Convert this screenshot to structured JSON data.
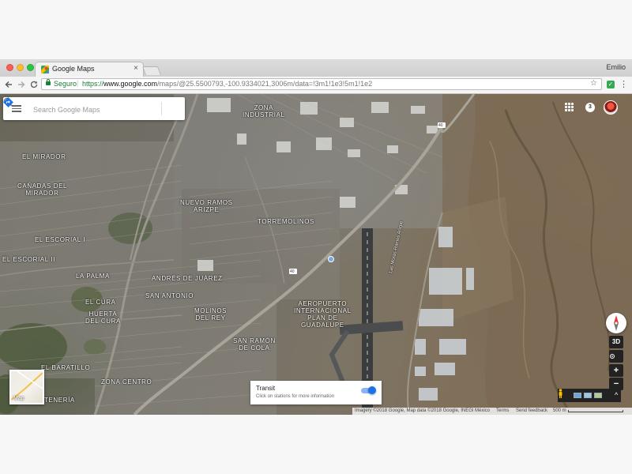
{
  "browser": {
    "tab_title": "Google Maps",
    "tab_close": "×",
    "profile_name": "Emilio",
    "secure_label": "Seguro",
    "url_scheme": "https://",
    "url_host": "www.google.com",
    "url_path": "/maps/@25.5500793,-100.9334021,3006m/data=!3m1!1e3!5m1!1e2",
    "back_icon": "arrow-left",
    "forward_icon": "arrow-right",
    "reload_icon": "reload",
    "star_icon": "star",
    "extension_icon": "check",
    "menu_icon": "vertical-dots"
  },
  "search": {
    "placeholder": "Search Google Maps"
  },
  "top_right": {
    "notification_count": "3"
  },
  "map_labels": [
    "ZONA\nINDUSTRIAL",
    "EL MIRADOR",
    "CAÑADAS DEL\nMIRADOR",
    "NUEVO RAMOS\nARIZPE",
    "TORREMOLINOS",
    "EL ESCORIAL I",
    "EL ESCORIAL II",
    "LA PALMA",
    "ANDRÉS DE JUÁREZ",
    "SAN ANTONIO",
    "EL CURA",
    "HUERTA\nDEL CURA",
    "MOLINOS\nDEL REY",
    "AEROPUERTO\nINTERNACIONAL\nPLAN DE\nGUADALUPE",
    "SAN RAMÓN\nDE COLA",
    "EL BARATILLO",
    "ZONA CENTRO",
    "TENERÍA",
    "Las Moras-Ramos Arizpe",
    "40",
    "40"
  ],
  "map_controls": {
    "tilt": "3D",
    "zoom_in": "+",
    "zoom_out": "−",
    "pegman_arrow": "^"
  },
  "map_type": {
    "label": "Map"
  },
  "transit": {
    "title": "Transit",
    "subtitle": "Click on stations for more information",
    "enabled": true
  },
  "footer": {
    "imagery": "Imagery ©2018 Google, Map data ©2018 Google, INEGI",
    "country": "México",
    "terms": "Terms",
    "feedback": "Send feedback",
    "scale": "500 m"
  },
  "colors": {
    "secure_green": "#188038",
    "google_blue": "#1a73e8",
    "transit_track": "#8ab4f8"
  }
}
